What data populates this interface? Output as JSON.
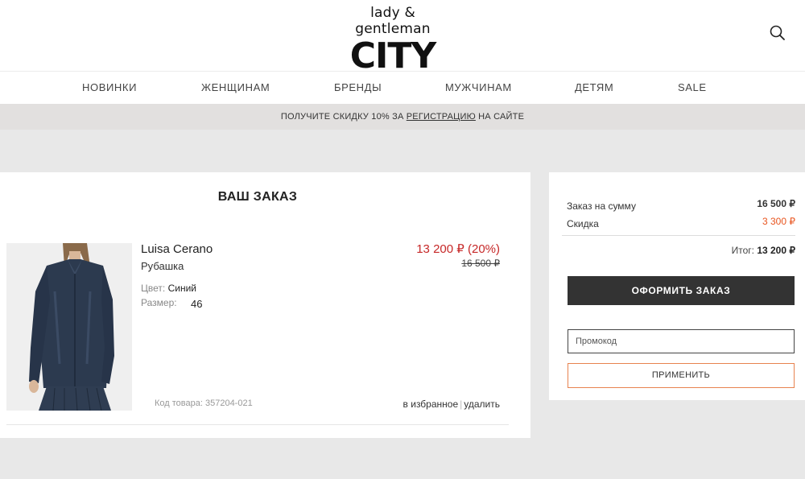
{
  "header": {
    "logo_top": "lady & gentleman",
    "logo_main": "CITY"
  },
  "nav": [
    {
      "label": "НОВИНКИ"
    },
    {
      "label": "ЖЕНЩИНАМ"
    },
    {
      "label": "БРЕНДЫ"
    },
    {
      "label": "МУЖЧИНАМ"
    },
    {
      "label": "ДЕТЯМ"
    },
    {
      "label": "SALE"
    }
  ],
  "promo": {
    "prefix": "ПОЛУЧИТЕ СКИДКУ 10% ЗА ",
    "link": "РЕГИСТРАЦИЮ",
    "suffix": " НА САЙТЕ"
  },
  "order": {
    "title": "ВАШ ЗАКАЗ",
    "item": {
      "brand": "Luisa Cerano",
      "type": "Рубашка",
      "color_label": "Цвет:",
      "color_value": "Синий",
      "size_label": "Размер:",
      "size_value": "46",
      "price_new": "13 200 ₽ (20%)",
      "price_old": "16 500 ₽",
      "sku": "Код товара: 357204-021",
      "favorite_label": "в избранное",
      "separator": "|",
      "remove_label": "удалить"
    }
  },
  "summary": {
    "subtotal_label": "Заказ на сумму",
    "subtotal_value": "16 500 ₽",
    "discount_label": "Скидка",
    "discount_value": "3 300 ₽",
    "total_label": "Итог:",
    "total_value": "13 200 ₽",
    "checkout_label": "ОФОРМИТЬ ЗАКАЗ",
    "promo_placeholder": "Промокод",
    "apply_label": "ПРИМЕНИТЬ"
  },
  "colors": {
    "sale_red": "#c62828",
    "discount_orange": "#e8541e",
    "apply_border": "#e8824f",
    "checkout_bg": "#333333"
  }
}
